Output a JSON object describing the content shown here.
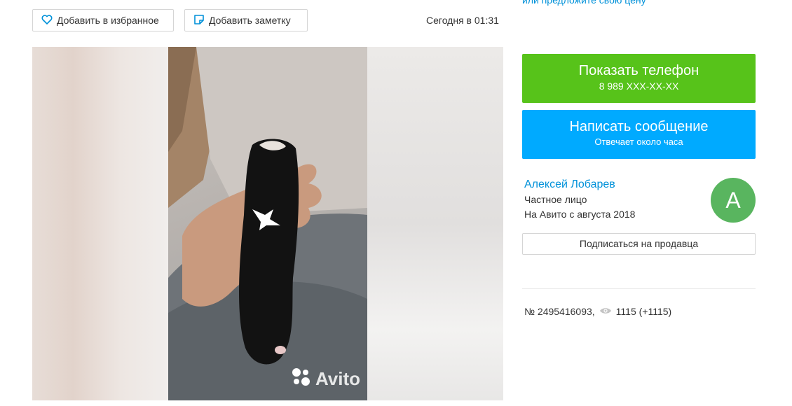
{
  "top_link": "или предложите свою цену",
  "actions": {
    "favorite_label": "Добавить в избранное",
    "note_label": "Добавить заметку",
    "posted_date": "Сегодня в 01:31"
  },
  "gallery": {
    "watermark": "Avito"
  },
  "contact": {
    "phone_title": "Показать телефон",
    "phone_number": "8 989 XXX-XX-XX",
    "message_title": "Написать сообщение",
    "message_subtitle": "Отвечает около часа",
    "phone_color": "#57c31a",
    "message_color": "#00aaff"
  },
  "seller": {
    "name": "Алексей Лобарев",
    "type": "Частное лицо",
    "since": "На Авито с августа 2018",
    "avatar_letter": "А",
    "avatar_color": "#59b55f",
    "subscribe_label": "Подписаться на продавца"
  },
  "ad": {
    "number": "№ 2495416093,",
    "views": "1115 (+1115)",
    "views_icon": "eye-icon"
  }
}
